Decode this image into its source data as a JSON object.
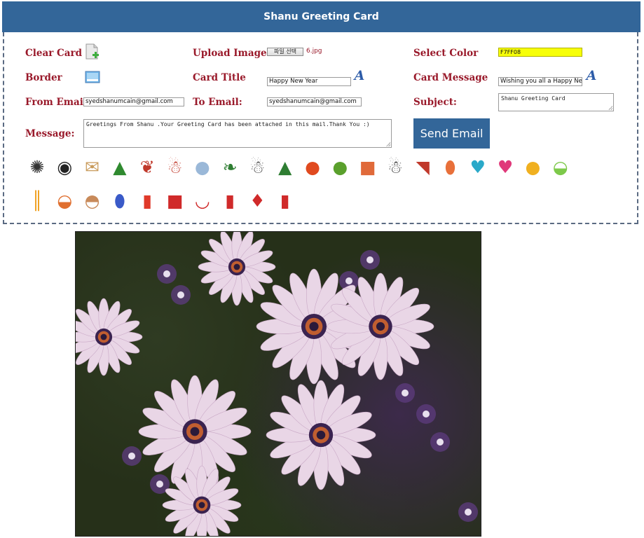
{
  "header": {
    "title": "Shanu Greeting Card"
  },
  "labels": {
    "clear_card": "Clear Card",
    "upload_image": "Upload Image :",
    "select_color": "Select Color",
    "border": "Border",
    "card_title": "Card Title",
    "card_message": "Card Message",
    "from_email": "From Email:",
    "to_email": "To Email:",
    "subject": "Subject:",
    "message": "Message:"
  },
  "upload": {
    "button_label": "파일 선택",
    "file_name": "6.jpg"
  },
  "fields": {
    "color_value": "F7FF08",
    "color_hex": "#f7ff08",
    "card_title_value": "Happy New Year",
    "card_message_value": "Wishing you all a Happy Ne",
    "from_email_value": "syedshanumcain@gmail.com",
    "to_email_value": "syedshanumcain@gmail.com",
    "subject_value": "Shanu Greeting Card",
    "message_value": "Greetings From Shanu .Your Greeting Card has been attached in this mail.Thank You :)"
  },
  "buttons": {
    "font_a": "A",
    "send_email": "Send Email"
  },
  "colors": {
    "header_bg": "#336699",
    "label_red": "#99192a",
    "button_bg": "#336699"
  },
  "icons": [
    {
      "name": "happy-new-year-sticker-icon",
      "glyph": "✺",
      "color": "#333333"
    },
    {
      "name": "year-2016-icon",
      "glyph": "◉",
      "color": "#222222"
    },
    {
      "name": "envelope-icon",
      "glyph": "✉",
      "color": "#c89a5a"
    },
    {
      "name": "christmas-tree-icon",
      "glyph": "▲",
      "color": "#2f8a2f"
    },
    {
      "name": "bells-bow-icon",
      "glyph": "❦",
      "color": "#c0392b"
    },
    {
      "name": "santa-icon",
      "glyph": "☃",
      "color": "#c0392b"
    },
    {
      "name": "snow-globe-icon",
      "glyph": "●",
      "color": "#9ab8d8"
    },
    {
      "name": "holly-icon",
      "glyph": "❧",
      "color": "#2e7d32"
    },
    {
      "name": "snowman-icon",
      "glyph": "☃",
      "color": "#555555"
    },
    {
      "name": "small-tree-icon",
      "glyph": "▲",
      "color": "#2e7d32"
    },
    {
      "name": "red-ornament-icon",
      "glyph": "●",
      "color": "#e04a1f"
    },
    {
      "name": "green-ornament-icon",
      "glyph": "●",
      "color": "#5aa02c"
    },
    {
      "name": "gift-box-icon",
      "glyph": "■",
      "color": "#e06a3a"
    },
    {
      "name": "snowman-hat-icon",
      "glyph": "☃",
      "color": "#444444"
    },
    {
      "name": "sleigh-icon",
      "glyph": "◥",
      "color": "#c0392b"
    },
    {
      "name": "balloon-icon",
      "glyph": "⬮",
      "color": "#e8703a"
    },
    {
      "name": "heart-balloons-icon",
      "glyph": "♥",
      "color": "#2aa9c9"
    },
    {
      "name": "pink-heart-icon",
      "glyph": "♥",
      "color": "#e0397a"
    },
    {
      "name": "balloons-icon",
      "glyph": "●",
      "color": "#f0b020"
    },
    {
      "name": "green-cake-icon",
      "glyph": "◒",
      "color": "#7dc94a"
    },
    {
      "name": "candles-icon",
      "glyph": "║",
      "color": "#f0a020"
    },
    {
      "name": "birthday-cake-icon",
      "glyph": "◒",
      "color": "#e07030"
    },
    {
      "name": "cupcake-icon",
      "glyph": "◓",
      "color": "#c88a5a"
    },
    {
      "name": "blue-egg-icon",
      "glyph": "⬮",
      "color": "#3a5ac8"
    },
    {
      "name": "candle-icon",
      "glyph": "▮",
      "color": "#e03a2a"
    },
    {
      "name": "red-gift-icon",
      "glyph": "■",
      "color": "#d02a2a"
    },
    {
      "name": "diya-lamp-icon",
      "glyph": "◡",
      "color": "#d02a2a"
    },
    {
      "name": "firecracker-icon",
      "glyph": "▮",
      "color": "#d02a2a"
    },
    {
      "name": "lantern-icon",
      "glyph": "♦",
      "color": "#d02a2a"
    },
    {
      "name": "rocket-cracker-icon",
      "glyph": "▮",
      "color": "#d02a2a"
    }
  ]
}
